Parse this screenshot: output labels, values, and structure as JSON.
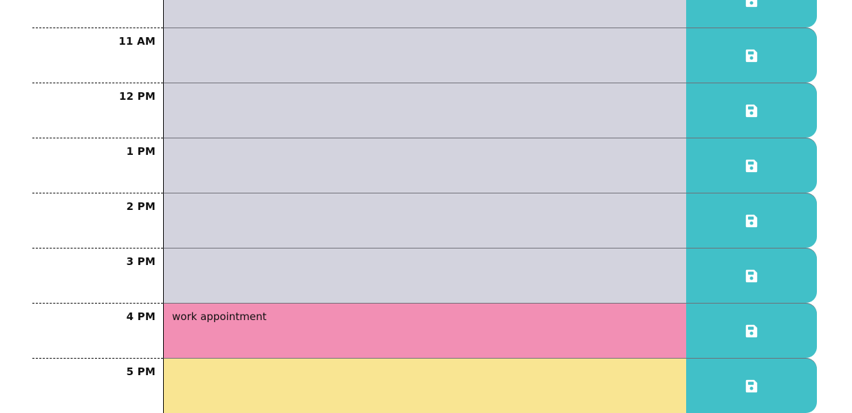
{
  "rows": [
    {
      "hour": "",
      "text": "",
      "state": "past"
    },
    {
      "hour": "11 AM",
      "text": "",
      "state": "past"
    },
    {
      "hour": "12 PM",
      "text": "",
      "state": "past"
    },
    {
      "hour": "1 PM",
      "text": "",
      "state": "past"
    },
    {
      "hour": "2 PM",
      "text": "",
      "state": "past"
    },
    {
      "hour": "3 PM",
      "text": "",
      "state": "past"
    },
    {
      "hour": "4 PM",
      "text": "work appointment",
      "state": "present"
    },
    {
      "hour": "5 PM",
      "text": "",
      "state": "future"
    }
  ],
  "colors": {
    "past": "#d3d3de",
    "present": "#f28fb4",
    "future": "#f9e592",
    "save": "#41c0c8"
  },
  "icons": {
    "save": "floppy-disk-icon"
  }
}
